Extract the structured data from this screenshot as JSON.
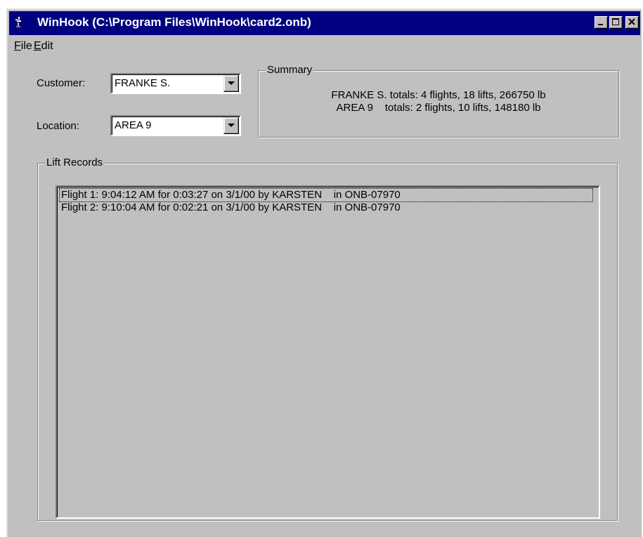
{
  "window": {
    "title": "WinHook (C:\\Program Files\\WinHook\\card2.onb)",
    "controls": [
      "minimize",
      "maximize",
      "close"
    ]
  },
  "menu": {
    "file_first": "F",
    "file_rest": "ile",
    "edit_first": "E",
    "edit_rest": "dit"
  },
  "form": {
    "customer_label": "Customer:",
    "customer_value": "FRANKE S.",
    "location_label": "Location:",
    "location_value": "AREA 9"
  },
  "summary": {
    "caption": "Summary",
    "line1": "FRANKE S. totals: 4 flights, 18 lifts, 266750 lb",
    "line2": "AREA 9    totals: 2 flights, 10 lifts, 148180 lb"
  },
  "lift_records": {
    "caption": "Lift Records",
    "rows": [
      "Flight 1: 9:04:12 AM for 0:03:27 on 3/1/00 by KARSTEN    in ONB-07970",
      "Flight 2: 9:10:04 AM for 0:02:21 on 3/1/00 by KARSTEN    in ONB-07970"
    ]
  },
  "colors": {
    "titlebar": "#000080",
    "face": "#c0c0c0"
  }
}
